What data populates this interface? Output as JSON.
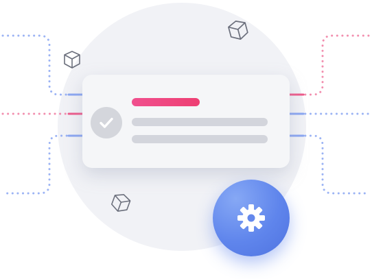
{
  "illustration": {
    "icons": {
      "status": "check-icon",
      "action": "gear-icon",
      "decor": "cube-icon"
    },
    "colors": {
      "background_circle": "#f1f2f6",
      "card": "#f5f6f8",
      "accent_pink": "#ee3f73",
      "accent_blue": "#6a8cf0",
      "neutral_bar": "#d3d5dc",
      "check_circle": "#d4d6dc"
    }
  }
}
